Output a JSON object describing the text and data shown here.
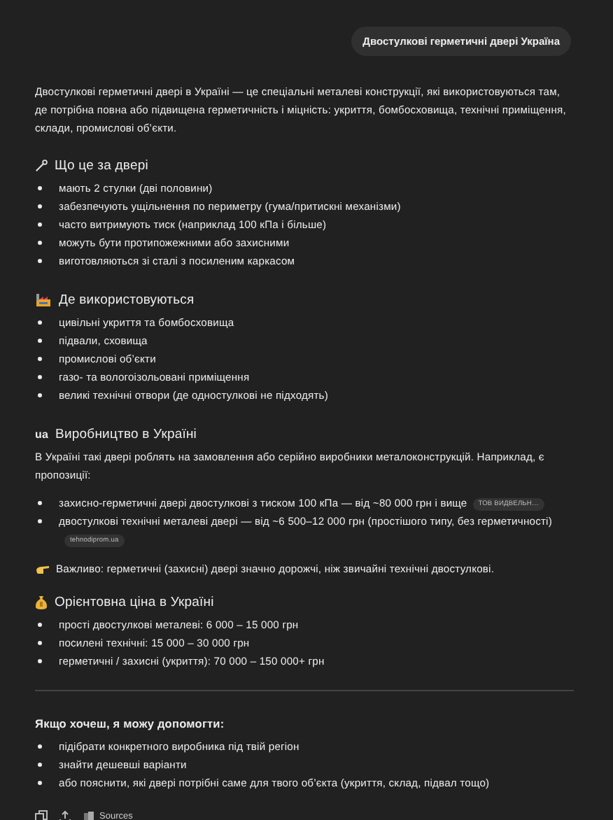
{
  "user_message": "Двостулкові герметичні двері Україна",
  "blocks": [
    {
      "kind": "paragraph",
      "text": "Двостулкові герметичні двері в Україні — це спеціальні металеві конструкції, які використовуються там, де потрібна повна або підвищена герметичність і міцність: укриття, бомбосховища, технічні приміщення, склади, промислові об’єкти."
    },
    {
      "kind": "heading",
      "text": "Що це за двері"
    },
    {
      "kind": "list",
      "items": [
        {
          "text": "мають 2 стулки (дві половини)"
        },
        {
          "text": "забезпечують ущільнення по периметру (гума/притискні механізми)"
        },
        {
          "text": "часто витримують тиск (наприклад 100 кПа і більше)"
        },
        {
          "text": "можуть бути протипожежними або захисними"
        },
        {
          "text": "виготовляються зі сталі з посиленим каркасом"
        }
      ]
    },
    {
      "kind": "heading",
      "text": "Де використовуються"
    },
    {
      "kind": "list",
      "items": [
        {
          "text": "цивільні укриття та бомбосховища"
        },
        {
          "text": "підвали, сховища"
        },
        {
          "text": "промислові об’єкти"
        },
        {
          "text": "газо- та вологоізольовані приміщення"
        },
        {
          "text": "великі технічні отвори (де одностулкові не підходять)"
        }
      ]
    },
    {
      "kind": "heading",
      "letters": "ua",
      "text": "Виробництво в Україні"
    },
    {
      "kind": "paragraph",
      "text": "В Україні такі двері роблять на замовлення або серійно виробники металоконструкцій. Наприклад, є пропозиції:"
    },
    {
      "kind": "list",
      "items": [
        {
          "text": "захисно-герметичні двері двостулкові з тиском 100 кПа — від ~80 000 грн і вище",
          "source": "ТОВ ВИДВЕЛЬН…"
        },
        {
          "text": "двостулкові технічні металеві двері — від ~6 500–12 000 грн (простішого типу, без герметичності)",
          "source": "tehnodiprom.ua"
        }
      ]
    },
    {
      "kind": "note",
      "text": "Важливо: герметичні (захисні) двері значно дорожчі, ніж звичайні технічні двостулкові."
    },
    {
      "kind": "heading",
      "text": "Орієнтовна ціна в Україні"
    },
    {
      "kind": "list",
      "items": [
        {
          "text": "прості двостулкові металеві: 6 000 – 15 000 грн"
        },
        {
          "text": "посилені технічні: 15 000 – 30 000 грн"
        },
        {
          "text": "герметичні / захисні (укриття): 70 000 – 150 000+ грн"
        }
      ]
    },
    {
      "kind": "divider"
    },
    {
      "kind": "lead",
      "text": "Якщо хочеш, я можу допомогти:"
    },
    {
      "kind": "list",
      "items": [
        {
          "text": "підібрати конкретного виробника під твій регіон"
        },
        {
          "text": "знайти дешевші варіанти"
        },
        {
          "text": "або пояснити, які двері потрібні саме для твого об’єкта (укриття, склад, підвал тощо)"
        }
      ]
    }
  ],
  "actions": {
    "sources_label": "Sources"
  }
}
